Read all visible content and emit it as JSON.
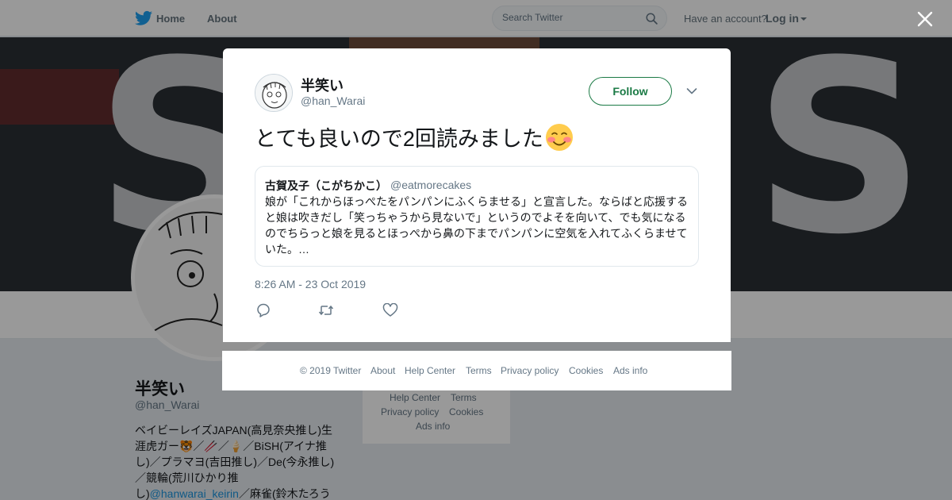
{
  "topbar": {
    "home_label": "Home",
    "about_label": "About",
    "search_placeholder": "Search Twitter",
    "have_account": "Have an account?",
    "login_label": "Log in"
  },
  "profile": {
    "name": "半笑い",
    "handle": "@han_Warai",
    "bio_part1": "ベイビーレイズJAPAN(高見奈央推し)生涯虎ガー🐯／🥢／🍦／BiSH(アイナ推し)／プラマヨ(吉田推し)／De(今永推し)／競輪(荒川ひかり推し)",
    "bio_link": "@hanwarai_keirin",
    "bio_part2": "／麻雀(鈴木たろう"
  },
  "bg_footer": {
    "items": [
      "Help Center",
      "Terms",
      "Privacy policy",
      "Cookies",
      "Ads info"
    ]
  },
  "tweet": {
    "author_name": "半笑い",
    "author_handle": "@han_Warai",
    "follow_label": "Follow",
    "text": "とても良いので2回読みました",
    "emoji": "smiling-face-with-blush",
    "timestamp": "8:26 AM - 23 Oct 2019",
    "quoted": {
      "author_name": "古賀及子（こがちかこ）",
      "author_handle": "@eatmorecakes",
      "text": "娘が「これからほっぺたをパンパンにふくらませる」と宣言した。ならばと応援すると娘は吹きだし「笑っちゃうから見ないで」というのでよそを向いて、でも気になるのでちらっと娘を見るとほっぺから鼻の下までパンパンに空気を入れてふくらませていた。…"
    }
  },
  "modal_footer": {
    "copyright": "© 2019 Twitter",
    "items": [
      "About",
      "Help Center",
      "Terms",
      "Privacy policy",
      "Cookies",
      "Ads info"
    ]
  },
  "colors": {
    "twitter_blue": "#1da1f2",
    "follow_green": "#1b7a45",
    "muted_text": "#657786",
    "overlay": "rgba(0,0,0,0.4)"
  }
}
